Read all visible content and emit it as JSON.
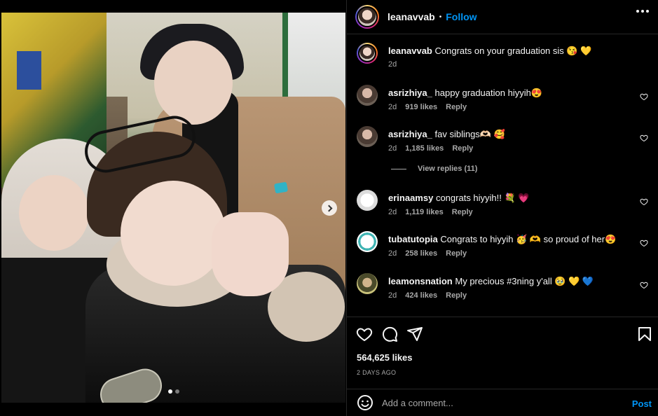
{
  "post": {
    "username": "leanavvab",
    "follow_label": "Follow",
    "separator": "•",
    "likes": "564,625 likes",
    "date": "2 DAYS AGO"
  },
  "caption": {
    "username": "leanavvab",
    "text": "Congrats on your graduation sis 😘 💛",
    "time": "2d"
  },
  "comments": [
    {
      "username": "asrizhiya_",
      "text": "happy graduation hiyyih😍",
      "time": "2d",
      "likes": "919 likes",
      "reply": "Reply"
    },
    {
      "username": "asrizhiya_",
      "text": "fav siblings🫶🏻 🥰",
      "time": "2d",
      "likes": "1,185 likes",
      "reply": "Reply"
    },
    {
      "username": "erinaamsy",
      "text": "congrats hiyyih!! 💐 💗",
      "time": "2d",
      "likes": "1,119 likes",
      "reply": "Reply"
    },
    {
      "username": "tubatutopia",
      "text": "Congrats to hiyyih 🥳 🫶 so proud of her😍",
      "time": "2d",
      "likes": "258 likes",
      "reply": "Reply"
    },
    {
      "username": "leamonsnation",
      "text": "My precious #3ning y'all 🥹 💛 💙",
      "time": "2d",
      "likes": "424 likes",
      "reply": "Reply"
    }
  ],
  "view_replies": "View replies (11)",
  "add_comment": {
    "placeholder": "Add a comment...",
    "post_label": "Post"
  },
  "colors": {
    "link": "#0095f6",
    "background": "#000000",
    "muted": "#a8a8a8",
    "divider": "#262626"
  },
  "icons": [
    "heart-icon",
    "comment-icon",
    "share-icon",
    "bookmark-icon",
    "emoji-icon",
    "more-icon",
    "next-arrow-icon"
  ],
  "carousel": {
    "slides": 2,
    "current": 1
  }
}
